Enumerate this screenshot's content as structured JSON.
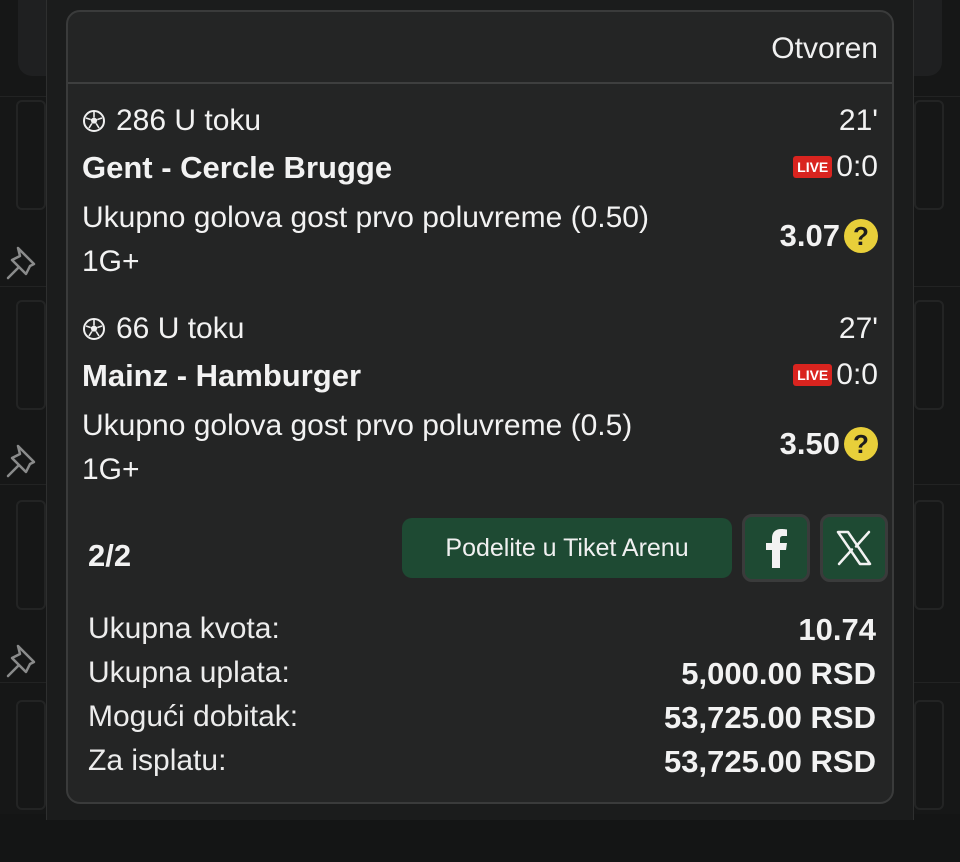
{
  "ticket": {
    "status": "Otvoren",
    "events": [
      {
        "code": "286",
        "state": "U toku",
        "minute": "21'",
        "teams": "Gent - Cercle Brugge",
        "live_label": "LIVE",
        "score": "0:0",
        "market_line1": "Ukupno golova gost prvo poluvreme (0.50)",
        "market_line2": "1G+",
        "odds": "3.07"
      },
      {
        "code": "66",
        "state": "U toku",
        "minute": "27'",
        "teams": "Mainz - Hamburger",
        "live_label": "LIVE",
        "score": "0:0",
        "market_line1": "Ukupno golova gost prvo poluvreme (0.5)",
        "market_line2": "1G+",
        "odds": "3.50"
      }
    ],
    "count": "2/2",
    "share_label": "Podelite u Tiket Arenu",
    "help_glyph": "?",
    "summary": {
      "total_odds_label": "Ukupna kvota:",
      "total_odds": "10.74",
      "stake_label": "Ukupna uplata:",
      "stake": "5,000.00 RSD",
      "potential_label": "Mogući dobitak:",
      "potential": "53,725.00 RSD",
      "payout_label": "Za isplatu:",
      "payout": "53,725.00 RSD"
    }
  },
  "icons": {
    "ball": "soccer-ball-icon",
    "pin": "pin-icon",
    "facebook": "facebook-icon",
    "x": "x-logo-icon",
    "help": "help-icon"
  },
  "colors": {
    "accent_green": "#1e4a33",
    "live_red": "#d9241f",
    "help_yellow": "#e8cf3a",
    "card_bg": "#242525"
  }
}
